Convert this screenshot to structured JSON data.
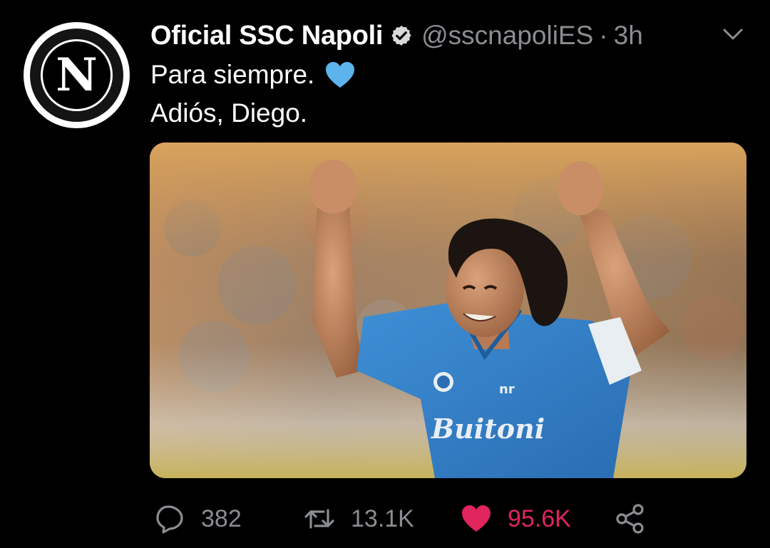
{
  "tweet": {
    "display_name": "Oficial SSC Napoli",
    "handle": "@sscnapoliES",
    "separator": "·",
    "time": "3h",
    "text_line1": "Para siempre.",
    "text_line2": "Adiós, Diego.",
    "avatar_letter": "N",
    "emoji": "blue-heart-icon"
  },
  "actions": {
    "reply_count": "382",
    "retweet_count": "13.1K",
    "like_count": "95.6K",
    "liked": true
  },
  "colors": {
    "background": "#000000",
    "text": "#ffffff",
    "secondary": "#8a8d91",
    "like": "#e0245e",
    "blue_heart": "#5db4ec"
  },
  "icons": [
    "verified-badge-icon",
    "chevron-down-icon",
    "reply-icon",
    "retweet-icon",
    "heart-icon",
    "share-icon"
  ]
}
